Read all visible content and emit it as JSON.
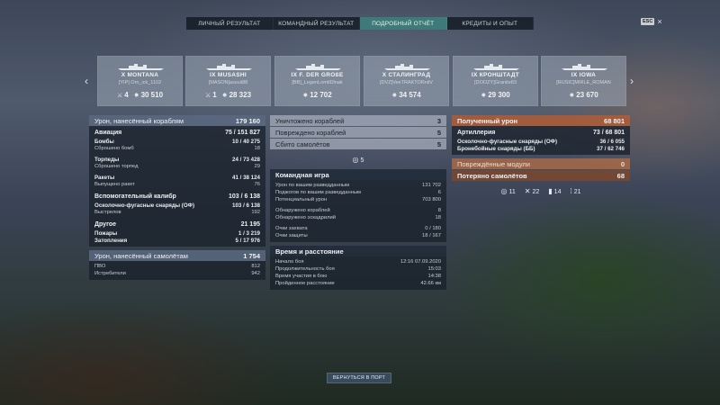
{
  "tabs": [
    {
      "label": "ЛИЧНЫЙ РЕЗУЛЬТАТ"
    },
    {
      "label": "КОМАНДНЫЙ РЕЗУЛЬТАТ"
    },
    {
      "label": "ПОДРОБНЫЙ ОТЧЁТ"
    },
    {
      "label": "КРЕДИТЫ И ОПЫТ"
    }
  ],
  "esc": {
    "key": "ESC",
    "close": "×"
  },
  "nav": {
    "prev": "‹",
    "next": "›"
  },
  "ships": [
    {
      "name": "X MONTANA",
      "player": "[YIP] Orn_ick_1102",
      "frags": "4",
      "damage": "30 510"
    },
    {
      "name": "IX MUSASHI",
      "player": "[MASON]assuii88",
      "frags": "1",
      "damage": "28 323"
    },
    {
      "name": "IX F. DER GROßE",
      "player": "[BB]_LegenLomtiDlnak",
      "frags": "",
      "damage": "12 702"
    },
    {
      "name": "X СТАЛИНГРАД",
      "player": "[DVZ]VeeTRAKTORniiV",
      "frags": "",
      "damage": "34 574"
    },
    {
      "name": "IX КРОНШТАДТ",
      "player": "[DOOZY]Granite83",
      "frags": "",
      "damage": "29 300"
    },
    {
      "name": "IX IOWA",
      "player": "[RUSIC]MIRLE_ROMAN",
      "frags": "",
      "damage": "23 670"
    }
  ],
  "left": {
    "damage_header": {
      "label": "Урон, нанесённый кораблям",
      "value": "179 160"
    },
    "aviation": {
      "label": "Авиация",
      "value": "75 / 151 827"
    },
    "bombs": {
      "label": "Бомбы",
      "value": "10 / 40 275"
    },
    "bombs_dropped": {
      "label": "Сброшено бомб",
      "value": "18"
    },
    "torpedoes": {
      "label": "Торпеды",
      "value": "24 / 73 428"
    },
    "torpedoes_dropped": {
      "label": "Сброшено торпед",
      "value": "29"
    },
    "rockets": {
      "label": "Ракеты",
      "value": "41 / 38 124"
    },
    "rockets_fired": {
      "label": "Выпущено ракет",
      "value": "76"
    },
    "secondary": {
      "label": "Вспомогательный калибр",
      "value": "103 / 6 138"
    },
    "he_shells": {
      "label": "Осколочно-фугасные снаряды (ОФ)",
      "value": "103 / 6 138"
    },
    "shots": {
      "label": "Выстрелов",
      "value": "192"
    },
    "other": {
      "label": "Другое",
      "value": "21 195"
    },
    "fires": {
      "label": "Пожары",
      "value": "1 / 3 219"
    },
    "floods": {
      "label": "Затопления",
      "value": "5 / 17 976"
    },
    "aircraft_damage": {
      "label": "Урон, нанесённый самолётам",
      "value": "1 754"
    },
    "aa": {
      "label": "ПВО",
      "value": "812"
    },
    "fighters": {
      "label": "Истребители",
      "value": "942"
    }
  },
  "middle": {
    "destroyed": {
      "label": "Уничтожено кораблей",
      "value": "3"
    },
    "damaged": {
      "label": "Повреждено кораблей",
      "value": "5"
    },
    "planes": {
      "label": "Сбито самолётов",
      "value": "5"
    },
    "spotted_icon_value": "5",
    "team_header": "Командная игра",
    "spot_damage": {
      "label": "Урон по вашим разведданным",
      "value": "131 702"
    },
    "spot_torps": {
      "label": "Поджогов по вашим разведданным",
      "value": "6"
    },
    "potential": {
      "label": "Потенциальный урон",
      "value": "703 800"
    },
    "ships_spotted": {
      "label": "Обнаружено кораблей",
      "value": "8"
    },
    "squadrons_spotted": {
      "label": "Обнаружено эскадрилий",
      "value": "18"
    },
    "capture": {
      "label": "Очки захвата",
      "value": "0 / 180"
    },
    "defense": {
      "label": "Очки защиты",
      "value": "18 / 167"
    },
    "time_header": "Время и расстояние",
    "battle_start": {
      "label": "Начало боя",
      "value": "12:16   07.09.2020"
    },
    "duration": {
      "label": "Продолжительность боя",
      "value": "15:03"
    },
    "participation": {
      "label": "Время участия в бою",
      "value": "14:38"
    },
    "distance": {
      "label": "Пройденное расстояние",
      "value": "42.66 км"
    }
  },
  "right": {
    "received": {
      "label": "Полученный урон",
      "value": "68 801"
    },
    "artillery": {
      "label": "Артиллерия",
      "value": "73 / 68 801"
    },
    "he": {
      "label": "Осколочно-фугасные снаряды (ОФ)",
      "value": "36 / 6 055"
    },
    "ap": {
      "label": "Бронебойные снаряды (ББ)",
      "value": "37 / 62 746"
    },
    "modules": {
      "label": "Повреждённые модули",
      "value": "0"
    },
    "planes_lost": {
      "label": "Потеряно самолётов",
      "value": "68"
    },
    "icons": [
      {
        "icon": "crosshair-icon",
        "value": "11"
      },
      {
        "icon": "fighter-icon",
        "value": "22"
      },
      {
        "icon": "bomb-icon",
        "value": "14"
      },
      {
        "icon": "rocket-icon",
        "value": "21"
      }
    ]
  },
  "return_button": "ВЕРНУТЬСЯ В ПОРТ"
}
